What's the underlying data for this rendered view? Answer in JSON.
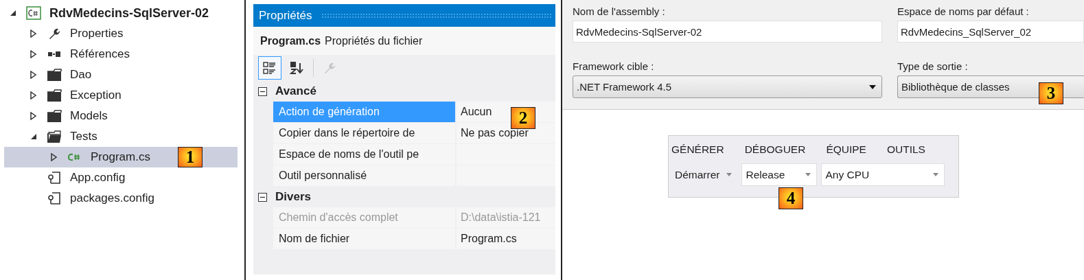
{
  "solution_explorer": {
    "callout": "1",
    "items": [
      {
        "label": "RdvMedecins-SqlServer-02",
        "kind": "project",
        "expandable": true,
        "expanded": true,
        "selected": false,
        "children": [
          {
            "label": "Properties",
            "kind": "properties",
            "expandable": true,
            "expanded": false,
            "selected": false
          },
          {
            "label": "Références",
            "kind": "references",
            "expandable": true,
            "expanded": false,
            "selected": false
          },
          {
            "label": "Dao",
            "kind": "folder",
            "expandable": true,
            "expanded": false,
            "selected": false
          },
          {
            "label": "Exception",
            "kind": "folder",
            "expandable": true,
            "expanded": false,
            "selected": false
          },
          {
            "label": "Models",
            "kind": "folder",
            "expandable": true,
            "expanded": false,
            "selected": false
          },
          {
            "label": "Tests",
            "kind": "folder",
            "expandable": true,
            "expanded": true,
            "selected": false,
            "children": [
              {
                "label": "Program.cs",
                "kind": "csharp",
                "expandable": true,
                "expanded": false,
                "selected": true
              }
            ]
          },
          {
            "label": "App.config",
            "kind": "config",
            "expandable": false,
            "selected": false
          },
          {
            "label": "packages.config",
            "kind": "config",
            "expandable": false,
            "selected": false
          }
        ]
      }
    ]
  },
  "properties": {
    "title": "Propriétés",
    "object_name": "Program.cs",
    "object_type": "Propriétés du fichier",
    "callout": "2",
    "toolbar": [
      {
        "kind": "categorized",
        "selected": true,
        "disabled": false
      },
      {
        "kind": "alphabetical",
        "selected": false,
        "disabled": false
      },
      {
        "kind": "property-pages",
        "selected": false,
        "disabled": true
      }
    ],
    "categories": [
      {
        "name": "Avancé",
        "expanded": true,
        "rows": [
          {
            "name": "Action de génération",
            "value": "Aucun",
            "selected": true,
            "disabled": false
          },
          {
            "name": "Copier dans le répertoire de",
            "value": "Ne pas copier",
            "selected": false,
            "disabled": false
          },
          {
            "name": "Espace de noms de l'outil pe",
            "selected": false,
            "disabled": false
          },
          {
            "name": "Outil personnalisé",
            "selected": false,
            "disabled": false
          }
        ]
      },
      {
        "name": "Divers",
        "expanded": true,
        "rows": [
          {
            "name": "Chemin d'accès complet",
            "value": "D:\\data\\istia-121",
            "selected": false,
            "disabled": true
          },
          {
            "name": "Nom de fichier",
            "value": "Program.cs",
            "selected": false,
            "disabled": false
          }
        ]
      }
    ]
  },
  "application_settings": {
    "callout": "3",
    "fields": [
      {
        "label": "Nom de l'assembly :",
        "value": "RdvMedecins-SqlServer-02",
        "kind": "text"
      },
      {
        "label": "Espace de noms par défaut :",
        "value": "RdvMedecins_SqlServer_02",
        "kind": "text"
      },
      {
        "label": "Framework cible :",
        "value": ".NET Framework 4.5",
        "kind": "dropdown"
      },
      {
        "label": "Type de sortie :",
        "value": "Bibliothèque de classes",
        "kind": "dropdown-cut"
      }
    ]
  },
  "vs_toolbar": {
    "callout": "4",
    "menu": [
      "GÉNÉRER",
      "DÉBOGUER",
      "ÉQUIPE",
      "OUTILS"
    ],
    "controls": [
      {
        "value": "Démarrer",
        "kind": "split-button"
      },
      {
        "value": "Release",
        "kind": "combo"
      },
      {
        "value": "Any CPU",
        "kind": "combo-wide"
      }
    ]
  }
}
